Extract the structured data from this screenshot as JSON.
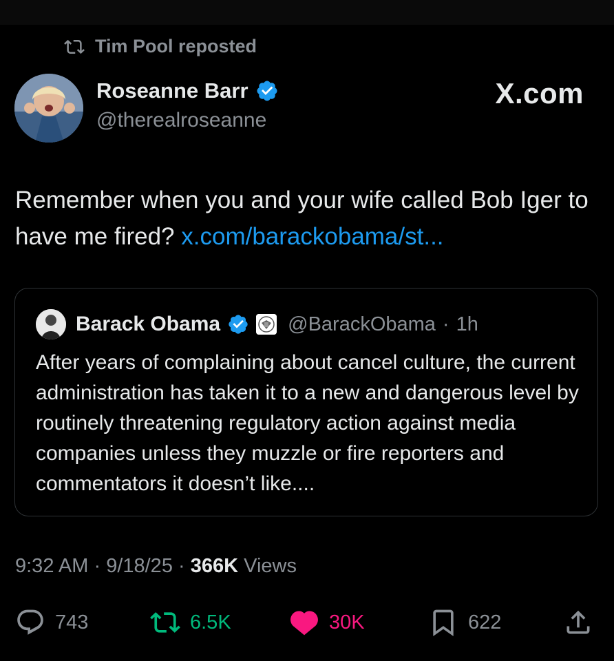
{
  "repost": {
    "label": "Tim Pool reposted"
  },
  "author": {
    "name": "Roseanne Barr",
    "handle": "@therealroseanne"
  },
  "watermark": "X.com",
  "tweet": {
    "text": "Remember when you and your wife called Bob Iger to have me fired?",
    "link": "x.com/barackobama/st..."
  },
  "quote": {
    "name": "Barack Obama",
    "handle": "@BarackObama",
    "time": "1h",
    "text": "After years of complaining about cancel culture, the current administration has taken it to a new and dangerous level by routinely threatening regulatory action against media companies unless they muzzle or fire reporters and commentators it doesn’t like...."
  },
  "meta": {
    "time": "9:32 AM",
    "date": "9/18/25",
    "views_count": "366K",
    "views_label": "Views"
  },
  "actions": {
    "replies": "743",
    "reposts": "6.5K",
    "likes": "30K",
    "bookmarks": "622"
  },
  "colors": {
    "link": "#1d9bf0",
    "repost": "#00ba7c",
    "like": "#f91880",
    "muted": "#8b9096",
    "verified": "#1d9bf0"
  }
}
